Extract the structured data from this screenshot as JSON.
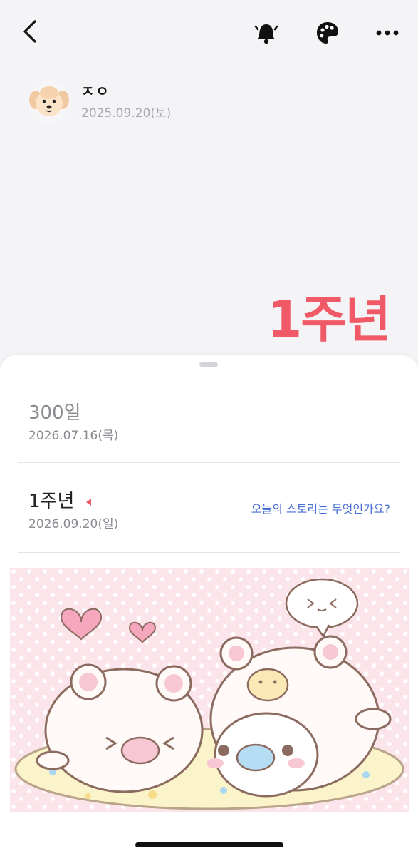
{
  "header": {
    "back_icon": "chevron-left-icon",
    "bell_icon": "bell-icon",
    "palette_icon": "palette-icon",
    "more_icon": "more-horizontal-icon"
  },
  "profile": {
    "name": "ㅈㅇ",
    "date": "2025.09.20(토)"
  },
  "hero": {
    "title": "1주년",
    "color": "#ef5a66"
  },
  "list": [
    {
      "title": "300일",
      "date": "2026.07.16(목)"
    },
    {
      "title": "1주년",
      "date": "2026.09.20(일)",
      "link": "오늘의 스토리는 무엇인가요?"
    }
  ],
  "colors": {
    "accent": "#ef5a66",
    "link": "#4a6fd6",
    "muted": "#8a8a90"
  }
}
